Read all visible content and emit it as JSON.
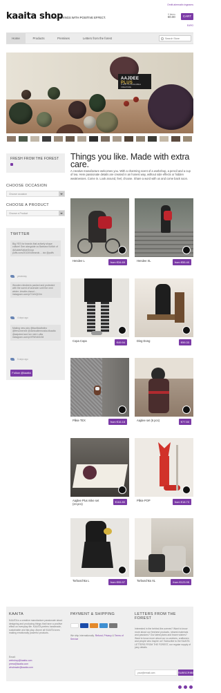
{
  "header": {
    "logo": "kaaita shop",
    "tagline": "LITTLE THINGS WITH POSITIVE EFFECT.",
    "signin": "Omitt alrematin ingeams",
    "cart_items": "0 items",
    "cart_total": "€0.00",
    "cart_label": "CART",
    "currency": "EURO"
  },
  "nav": {
    "items": [
      "Home",
      "Products",
      "Premises",
      "Letters from the forest"
    ],
    "search_placeholder": "Search Store"
  },
  "hero": {
    "badge_title": "AAJDEE",
    "badge_title_accent": "PLUS",
    "badge_sub": "A SOFT & HUGGABLE CREATURE"
  },
  "sidebar": {
    "fresh_title": "FRESH FROM THE FOREST",
    "occasion_heading": "CHOOSE OCCASION",
    "occasion_value": "Choose occasion",
    "product_heading": "CHOOSE A PRODUCT",
    "product_value": "Choose a Product",
    "twitter_heading": "TWITTER",
    "tweets": [
      {
        "text": "Big YES for brands that actively shape culture! See alongside us Barbara Kutlich of @AddedValueGroup puffs.com/2013/04/brands ... via @puffs",
        "meta": "yesterday"
      },
      {
        "text": "Wooden reindeers packed and protected with the scent of lavender until the next winter. #moths #wool... instagram.com/p/Y1ehQ0Jm",
        "meta": "4 days ago"
      },
      {
        "text": "Making new pics @tiaoficialbotho @fersomenne @dontcallmeuraka #kaaita @adpdesf and her mini Lullia instagram.com/p/XRWnbGvNl",
        "meta": "5 days ago"
      }
    ],
    "follow_label": "Follow @kaaita"
  },
  "main": {
    "headline": "Things you like. Made with extra care.",
    "intro": "A creative manufacture welcomes you. With a charming scent of a workshop, a pencil and a cup of tea. Here passionate details are created in an honest way, without side effects or hidden weaknesses. Come in. Look around, feel, choose. Share a word with us and come back soon.",
    "products": [
      {
        "name": "Hendee L",
        "price": "from €34.69"
      },
      {
        "name": "Hendee XL",
        "price": "from €55.40"
      },
      {
        "name": "Copa Copa",
        "price": "€49.94"
      },
      {
        "name": "Ding Dong",
        "price": "€99.33"
      },
      {
        "name": "Plikie TEX",
        "price": "from €16.18"
      },
      {
        "name": "Aajdee set (6 pcs)",
        "price": "€77.50"
      },
      {
        "name": "Aajdee Plus mike set (24 pcs)",
        "price": "€164.80"
      },
      {
        "name": "Plikie POP",
        "price": "from €18.73"
      },
      {
        "name": "Torbuschka L",
        "price": "from €95.97"
      },
      {
        "name": "Torbuschka XL",
        "price": "from €123.95"
      }
    ]
  },
  "footer": {
    "about_heading": "KAAITA",
    "about_text": "KAAITA is a creative manufacture passionate about designing and producing things that have a positive effect on everyday life. KAAITA prefers handmade, sustainable and fair-play. Above all KAAITA loves making emotionally powerful products.",
    "email_label": "Email:",
    "emails": [
      "webshop@kaaita.com",
      "press@kaaita.com",
      "wholesale@kaaita.com"
    ],
    "payment_heading": "PAYMENT & SHIPPING",
    "payment_text_1": "We ship internationally.",
    "refund_link": "Refund",
    "privacy_link": "Privacy",
    "terms_link": "Terms of Service",
    "letters_heading": "LETTERS FROM THE FOREST",
    "letters_text": "Interested in the behind-the-scenes? Want to know more about our freshest products, newest materials and passions? Our latest plans and brave wishes? Want to know more about our co-workers, craftsmen and people who inspire us? Subscribe to the KAAITA LETTERS FROM THE FOREST, our regular supply of juicy details.",
    "email_placeholder": "your@email.com",
    "subscribe_label": "SUBSCRIBE"
  },
  "colors": {
    "accent": "#7b3aa6",
    "panel": "#eeeeee"
  }
}
